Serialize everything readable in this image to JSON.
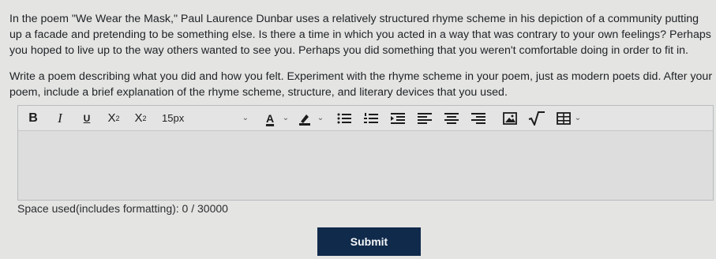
{
  "prompt": {
    "paragraph1": "In the poem \"We Wear the Mask,\" Paul Laurence Dunbar uses a relatively structured rhyme scheme in his depiction of a community putting up a facade and pretending to be something else. Is there a time in which you acted in a way that was contrary to your own feelings? Perhaps you hoped to live up to the way others wanted to see you. Perhaps you did something that you weren't comfortable doing in order to fit in.",
    "paragraph2": "Write a poem describing what you did and how you felt. Experiment with the rhyme scheme in your poem, just as modern poets did. After your poem, include a brief explanation of the rhyme scheme, structure, and literary devices that you used."
  },
  "toolbar": {
    "bold": "B",
    "italic": "I",
    "underline": "U",
    "superscript_base": "X",
    "superscript_mark": "2",
    "subscript_base": "X",
    "subscript_mark": "2",
    "font_size": "15px",
    "text_color": "A"
  },
  "editor": {
    "value": ""
  },
  "counter": {
    "text": "Space used(includes formatting): 0 / 30000"
  },
  "submit": {
    "label": "Submit"
  }
}
